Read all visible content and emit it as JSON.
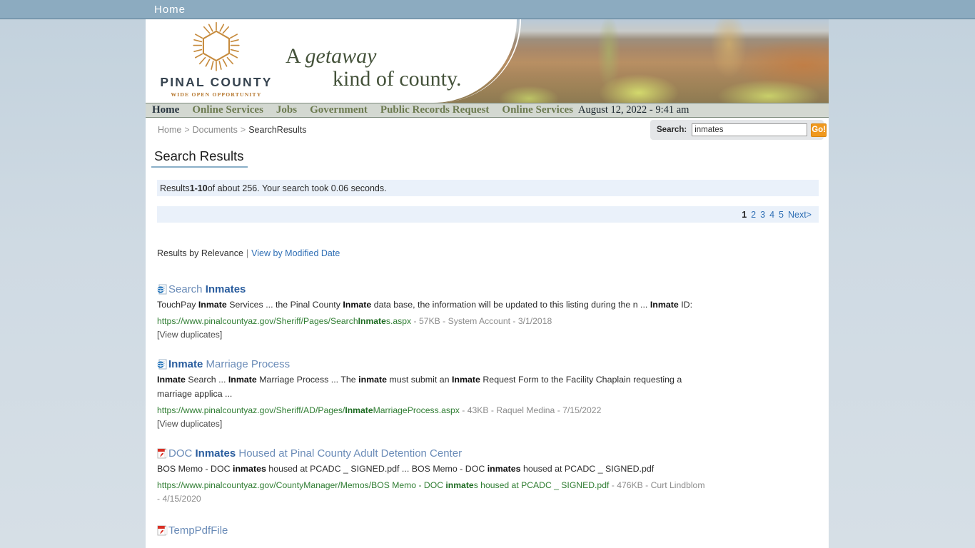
{
  "browser": {
    "tab_label": "Home"
  },
  "masthead": {
    "logo_name": "PINAL COUNTY",
    "logo_tagline": "WIDE OPEN OPPORTUNITY",
    "tagline_line1_prefix": "A ",
    "tagline_line1_italic": "getaway",
    "tagline_line2": "kind of county."
  },
  "nav": {
    "items": [
      {
        "label": "Home",
        "current": true
      },
      {
        "label": "Online Services",
        "current": false
      },
      {
        "label": "Jobs",
        "current": false
      },
      {
        "label": "Government",
        "current": false
      },
      {
        "label": "Public Records Request",
        "current": false
      },
      {
        "label": "Online Services",
        "current": false
      }
    ],
    "date": "August 12, 2022 - 9:41 am"
  },
  "breadcrumb": {
    "items": [
      "Home",
      "Documents",
      "SearchResults"
    ],
    "separator": ">"
  },
  "search": {
    "label": "Search:",
    "value": "inmates",
    "placeholder": "",
    "button_label": "Go!"
  },
  "page": {
    "title": "Search Results",
    "info_prefix": "Results ",
    "info_range": "1-10",
    "info_suffix": " of about 256. Your search took 0.06 seconds."
  },
  "pagination": {
    "pages": [
      "1",
      "2",
      "3",
      "4",
      "5"
    ],
    "current": "1",
    "next_label": "Next>"
  },
  "sort": {
    "active_label": "Results by Relevance",
    "divider": "|",
    "alt_label": "View by Modified Date"
  },
  "results": [
    {
      "icon": "ie-page-icon",
      "title_parts": [
        {
          "t": "Search ",
          "hl": false
        },
        {
          "t": "Inmates",
          "hl": true
        }
      ],
      "snippet_parts": [
        {
          "t": "TouchPay ",
          "b": false
        },
        {
          "t": "Inmate",
          "b": true
        },
        {
          "t": " Services ... the Pinal County ",
          "b": false
        },
        {
          "t": "Inmate",
          "b": true
        },
        {
          "t": " data base, the information will be updated to this listing during the n ... ",
          "b": false
        },
        {
          "t": "Inmate",
          "b": true
        },
        {
          "t": " ID:",
          "b": false
        }
      ],
      "url_parts": [
        {
          "t": "https://www.pinalcountyaz.gov/Sheriff/Pages/Search",
          "b": false
        },
        {
          "t": "Inmate",
          "b": true
        },
        {
          "t": "s.aspx",
          "b": false
        }
      ],
      "meta": " - 57KB - System Account - 3/1/2018",
      "duplicates_label": "[View duplicates]"
    },
    {
      "icon": "ie-page-icon",
      "title_parts": [
        {
          "t": "Inmate",
          "hl": true
        },
        {
          "t": " Marriage Process",
          "hl": false
        }
      ],
      "snippet_parts": [
        {
          "t": "Inmate",
          "b": true
        },
        {
          "t": " Search ... ",
          "b": false
        },
        {
          "t": "Inmate",
          "b": true
        },
        {
          "t": " Marriage Process ... The ",
          "b": false
        },
        {
          "t": "inmate",
          "b": true
        },
        {
          "t": " must submit an ",
          "b": false
        },
        {
          "t": "Inmate",
          "b": true
        },
        {
          "t": " Request Form to the Facility Chaplain requesting a marriage applica ...",
          "b": false
        }
      ],
      "url_parts": [
        {
          "t": "https://www.pinalcountyaz.gov/Sheriff/AD/Pages/",
          "b": false
        },
        {
          "t": "Inmate",
          "b": true
        },
        {
          "t": "MarriageProcess.aspx",
          "b": false
        }
      ],
      "meta": " - 43KB - Raquel Medina - 7/15/2022",
      "duplicates_label": "[View duplicates]"
    },
    {
      "icon": "pdf-icon",
      "title_parts": [
        {
          "t": "DOC ",
          "hl": false
        },
        {
          "t": "Inmates",
          "hl": true
        },
        {
          "t": " Housed at Pinal County Adult Detention Center",
          "hl": false
        }
      ],
      "snippet_parts": [
        {
          "t": "BOS Memo - DOC ",
          "b": false
        },
        {
          "t": "inmates",
          "b": true
        },
        {
          "t": " housed at PCADC _ SIGNED.pdf ... BOS Memo - DOC ",
          "b": false
        },
        {
          "t": "inmates",
          "b": true
        },
        {
          "t": " housed at PCADC _ SIGNED.pdf",
          "b": false
        }
      ],
      "url_parts": [
        {
          "t": "https://www.pinalcountyaz.gov/CountyManager/Memos/BOS Memo - DOC ",
          "b": false
        },
        {
          "t": "inmate",
          "b": true
        },
        {
          "t": "s housed at PCADC _ SIGNED.pdf",
          "b": false
        }
      ],
      "meta": " - 476KB - Curt Lindblom - 4/15/2020",
      "duplicates_label": ""
    },
    {
      "icon": "pdf-icon",
      "title_parts": [
        {
          "t": "TempPdfFile",
          "hl": false
        }
      ],
      "snippet_parts": [],
      "url_parts": [],
      "meta": "",
      "duplicates_label": ""
    }
  ],
  "colors": {
    "accent_blue": "#8aafc8",
    "nav_green": "#6c7a50",
    "url_green": "#2f7d32",
    "link_blue": "#2f6fb5",
    "go_orange": "#f0981d",
    "infobar_blue": "#eaf1fa",
    "page_bg": "#c3d2dd"
  }
}
